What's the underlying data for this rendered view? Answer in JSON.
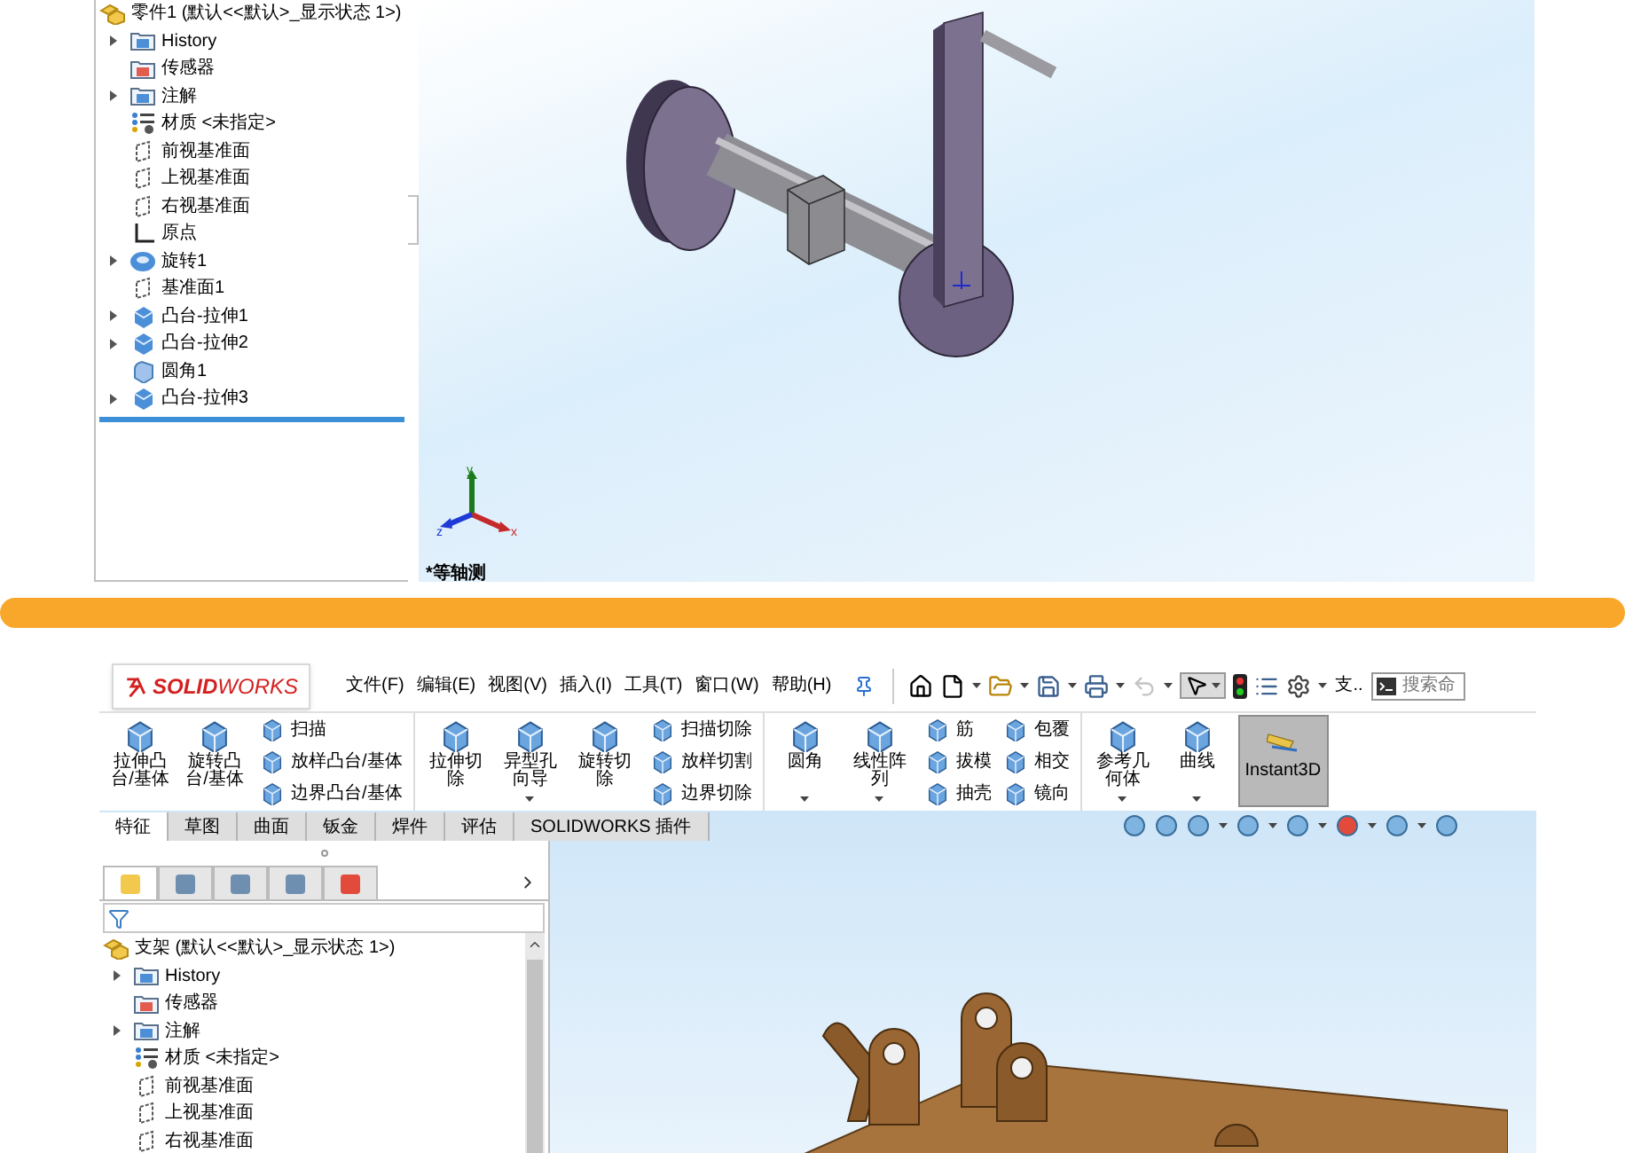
{
  "top_view": {
    "tree": {
      "root": "零件1 (默认<<默认>_显示状态 1>)",
      "items": [
        {
          "label": "History",
          "kind": "history",
          "expandable": true
        },
        {
          "label": "传感器",
          "kind": "sensor",
          "expandable": false
        },
        {
          "label": "注解",
          "kind": "annotation",
          "expandable": true
        },
        {
          "label": "材质 <未指定>",
          "kind": "material",
          "expandable": false
        },
        {
          "label": "前视基准面",
          "kind": "plane",
          "expandable": false
        },
        {
          "label": "上视基准面",
          "kind": "plane",
          "expandable": false
        },
        {
          "label": "右视基准面",
          "kind": "plane",
          "expandable": false
        },
        {
          "label": "原点",
          "kind": "origin",
          "expandable": false
        },
        {
          "label": "旋转1",
          "kind": "revolve",
          "expandable": true
        },
        {
          "label": "基准面1",
          "kind": "plane",
          "expandable": false
        },
        {
          "label": "凸台-拉伸1",
          "kind": "extrude",
          "expandable": true
        },
        {
          "label": "凸台-拉伸2",
          "kind": "extrude",
          "expandable": true
        },
        {
          "label": "圆角1",
          "kind": "fillet",
          "expandable": false
        },
        {
          "label": "凸台-拉伸3",
          "kind": "extrude",
          "expandable": true
        }
      ]
    },
    "triad": {
      "x": "x",
      "y": "y",
      "z": "z"
    },
    "view_label": "*等轴测"
  },
  "bottom_view": {
    "logo": "**SOLID**WORKS",
    "menu": [
      "文件(F)",
      "编辑(E)",
      "视图(V)",
      "插入(I)",
      "工具(T)",
      "窗口(W)",
      "帮助(H)"
    ],
    "toolbar": {
      "undo": {
        "disabled": true
      },
      "select": {
        "on": true
      },
      "cut_label": "支..",
      "search_placeholder": "搜索命"
    },
    "ribbon": [
      {
        "items": [
          {
            "kind": "large",
            "label": "拉伸凸台/基体",
            "dropdown": false
          },
          {
            "kind": "large",
            "label": "旋转凸台/基体",
            "dropdown": false
          },
          {
            "kind": "stack",
            "labels": [
              "扫描",
              "放样凸台/基体",
              "边界凸台/基体"
            ]
          }
        ]
      },
      {
        "items": [
          {
            "kind": "large",
            "label": "拉伸切除",
            "dropdown": false
          },
          {
            "kind": "large",
            "label": "异型孔向导",
            "dropdown": true
          },
          {
            "kind": "large",
            "label": "旋转切除",
            "dropdown": false
          },
          {
            "kind": "stack",
            "labels": [
              "扫描切除",
              "放样切割",
              "边界切除"
            ]
          }
        ]
      },
      {
        "items": [
          {
            "kind": "large",
            "label": "圆角",
            "dropdown": true
          },
          {
            "kind": "large",
            "label": "线性阵列",
            "dropdown": true
          },
          {
            "kind": "stack",
            "labels": [
              "筋",
              "拔模",
              "抽壳"
            ]
          },
          {
            "kind": "stack",
            "labels": [
              "包覆",
              "相交",
              "镜向"
            ]
          }
        ]
      },
      {
        "items": [
          {
            "kind": "large",
            "label": "参考几何体",
            "dropdown": true
          },
          {
            "kind": "large",
            "label": "曲线",
            "dropdown": true
          },
          {
            "kind": "toggle",
            "label": "Instant3D",
            "on": true
          }
        ]
      }
    ],
    "tabs": [
      {
        "label": "特征",
        "selected": true
      },
      {
        "label": "草图",
        "selected": false
      },
      {
        "label": "曲面",
        "selected": false
      },
      {
        "label": "钣金",
        "selected": false
      },
      {
        "label": "焊件",
        "selected": false
      },
      {
        "label": "评估",
        "selected": false
      },
      {
        "label": "SOLIDWORKS 插件",
        "selected": false
      }
    ],
    "panel_tabs": [
      {
        "selected": true
      },
      {
        "selected": false
      },
      {
        "selected": false
      },
      {
        "selected": false
      },
      {
        "selected": false
      }
    ],
    "tree": {
      "root": "支架 (默认<<默认>_显示状态 1>)",
      "items": [
        {
          "label": "History",
          "kind": "history",
          "expandable": true
        },
        {
          "label": "传感器",
          "kind": "sensor",
          "expandable": false
        },
        {
          "label": "注解",
          "kind": "annotation",
          "expandable": true
        },
        {
          "label": "材质 <未指定>",
          "kind": "material",
          "expandable": false
        },
        {
          "label": "前视基准面",
          "kind": "plane",
          "expandable": false
        },
        {
          "label": "上视基准面",
          "kind": "plane",
          "expandable": false
        },
        {
          "label": "右视基准面",
          "kind": "plane",
          "expandable": false
        }
      ]
    }
  }
}
